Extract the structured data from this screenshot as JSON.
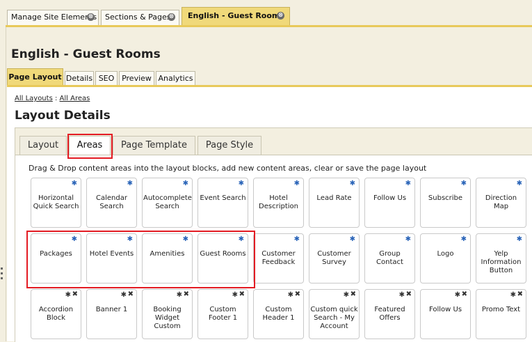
{
  "top_tabs": [
    {
      "label": "Manage Site Elements"
    },
    {
      "label": "Sections & Pages"
    },
    {
      "label": "English - Guest Rooms"
    }
  ],
  "close_glyph": "⊗",
  "page_title": "English - Guest Rooms",
  "page_tabs": [
    {
      "label": "Page Layout"
    },
    {
      "label": "Details"
    },
    {
      "label": "SEO"
    },
    {
      "label": "Preview"
    },
    {
      "label": "Analytics"
    }
  ],
  "breadcrumb": {
    "first": "All Layouts",
    "separator": ":",
    "second": "All Areas"
  },
  "section_title": "Layout Details",
  "inner_tabs": [
    {
      "label": "Layout"
    },
    {
      "label": "Areas"
    },
    {
      "label": "Page Template"
    },
    {
      "label": "Page Style"
    }
  ],
  "instructions": "Drag & Drop content areas into the layout blocks, add new content areas, clear or save the page layout",
  "tiles_row1": [
    {
      "label": "Horizontal Quick Search"
    },
    {
      "label": "Calendar Search"
    },
    {
      "label": "Autocomplete Search"
    },
    {
      "label": "Event Search"
    },
    {
      "label": "Hotel Description"
    },
    {
      "label": "Lead Rate"
    },
    {
      "label": "Follow Us"
    },
    {
      "label": "Subscribe"
    },
    {
      "label": "Direction Map"
    }
  ],
  "tiles_row2": [
    {
      "label": "Packages"
    },
    {
      "label": "Hotel Events"
    },
    {
      "label": "Amenities"
    },
    {
      "label": "Guest Rooms"
    },
    {
      "label": "Customer Feedback"
    },
    {
      "label": "Customer Survey"
    },
    {
      "label": "Group Contact"
    },
    {
      "label": "Logo"
    },
    {
      "label": "Yelp Information Button"
    }
  ],
  "tiles_row3": [
    {
      "label": "Accordion Block"
    },
    {
      "label": "Banner 1"
    },
    {
      "label": "Booking Widget Custom"
    },
    {
      "label": "Custom Footer 1"
    },
    {
      "label": "Custom Header 1"
    },
    {
      "label": "Custom quick Search - My Account"
    },
    {
      "label": "Featured Offers"
    },
    {
      "label": "Follow Us"
    },
    {
      "label": "Promo Text"
    }
  ],
  "icons": {
    "gear": "✱",
    "delete": "✖"
  },
  "colors": {
    "accent_gold": "#f0d97a",
    "highlight_red": "#e31b23",
    "gear_blue": "#2a64b8"
  }
}
